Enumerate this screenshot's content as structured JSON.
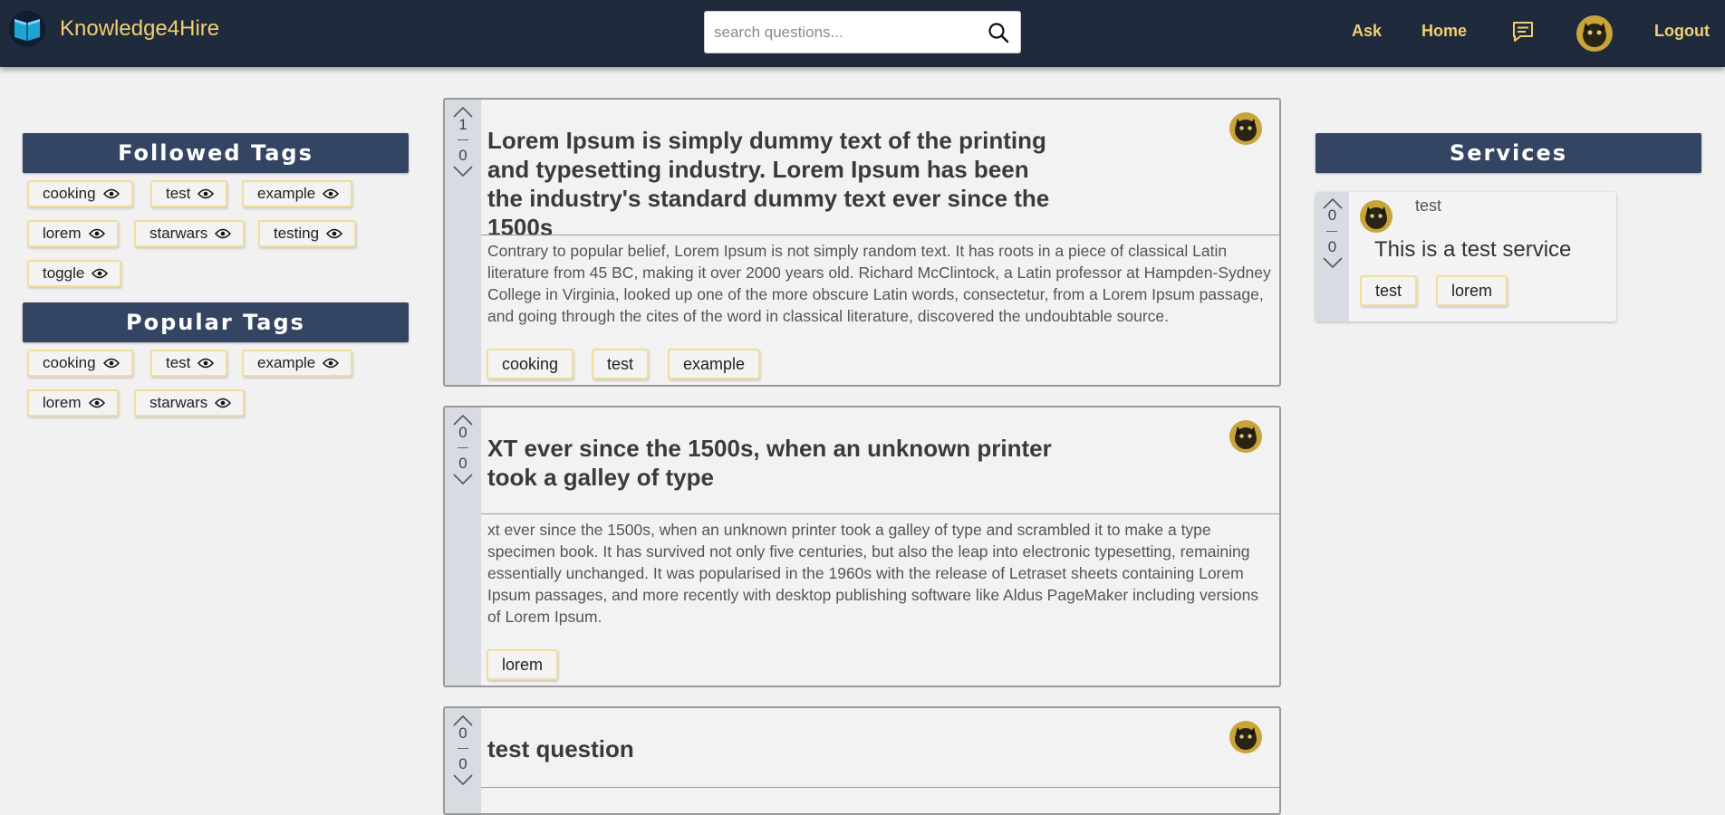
{
  "colors": {
    "navbar": "#1f2b3d",
    "accent": "#f2cf6e",
    "panel_header": "#344563",
    "tag_border": "#f1dd9c",
    "page_bg": "#f1f1f1",
    "vote_column": "#d9dbe3"
  },
  "navbar": {
    "brand": "Knowledge4Hire",
    "brand_icon": "open-book-icon",
    "search_placeholder": "search questions...",
    "links": {
      "ask": "Ask",
      "home": "Home",
      "logout": "Logout"
    },
    "chat_icon": "chat-bubble-icon"
  },
  "followed_tags": {
    "title": "Followed Tags",
    "tags": [
      "cooking",
      "test",
      "example",
      "lorem",
      "starwars",
      "testing",
      "toggle"
    ]
  },
  "popular_tags": {
    "title": "Popular Tags",
    "tags": [
      "cooking",
      "test",
      "example",
      "lorem",
      "starwars"
    ]
  },
  "questions": [
    {
      "upvotes": "1",
      "downvotes": "0",
      "title": "Lorem Ipsum is simply dummy text of the printing and typesetting industry. Lorem Ipsum has been the industry's standard dummy text ever since the 1500s",
      "body": "Contrary to popular belief, Lorem Ipsum is not simply random text. It has roots in a piece of classical Latin literature from 45 BC, making it over 2000 years old. Richard McClintock, a Latin professor at Hampden-Sydney College in Virginia, looked up one of the more obscure Latin words, consectetur, from a Lorem Ipsum passage, and going through the cites of the word in classical literature, discovered the undoubtable source.",
      "tags": [
        "cooking",
        "test",
        "example"
      ]
    },
    {
      "upvotes": "0",
      "downvotes": "0",
      "title": "XT ever since the 1500s, when an unknown printer took a galley of type",
      "body": "xt ever since the 1500s, when an unknown printer took a galley of type and scrambled it to make a type specimen book. It has survived not only five centuries, but also the leap into electronic typesetting, remaining essentially unchanged. It was popularised in the 1960s with the release of Letraset sheets containing Lorem Ipsum passages, and more recently with desktop publishing software like Aldus PageMaker including versions of Lorem Ipsum.",
      "tags": [
        "lorem"
      ]
    },
    {
      "upvotes": "0",
      "downvotes": "0",
      "title": "test question"
    }
  ],
  "services": {
    "title": "Services",
    "items": [
      {
        "upvotes": "0",
        "downvotes": "0",
        "user": "test",
        "description": "This is a test service",
        "tags": [
          "test",
          "lorem"
        ]
      }
    ]
  }
}
